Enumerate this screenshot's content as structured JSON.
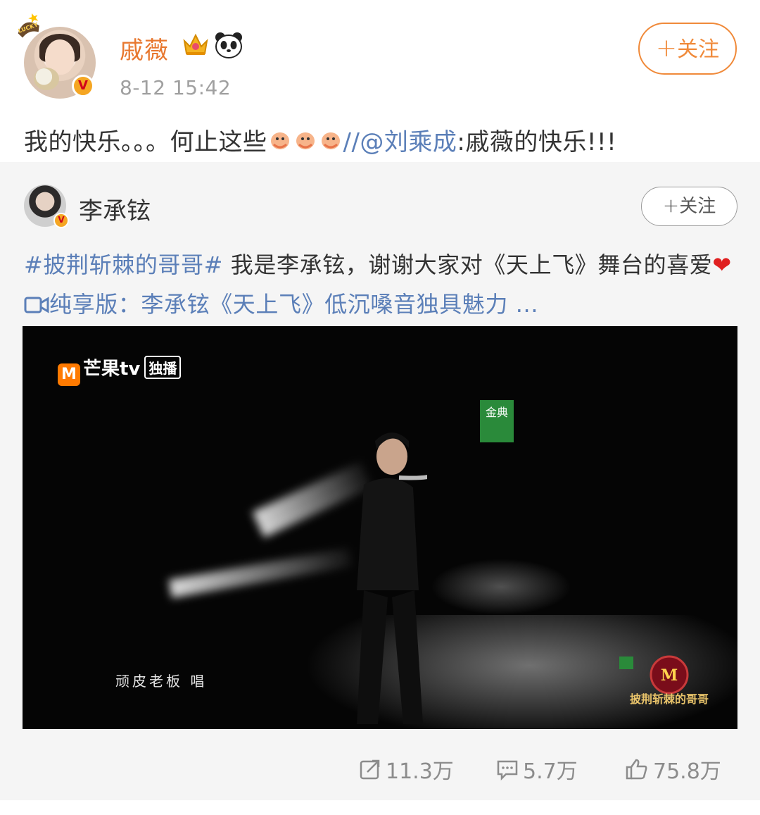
{
  "post": {
    "username": "戚薇",
    "timestamp": "8-12 15:42",
    "follow_label": "关注",
    "text_before": "我的快乐。。。何止这些",
    "text_mention": "//@刘乘成",
    "text_after": ":戚薇的快乐!!!",
    "avatar_badge": "LUCKY"
  },
  "repost": {
    "username": "李承铉",
    "follow_label": "关注",
    "hashtag": "#披荆斩棘的哥哥#",
    "text_main": " 我是李承铉，谢谢大家对《天上飞》舞台的喜爱",
    "link_text": "纯享版：李承铉《天上飞》低沉嗓音独具魅力 ...",
    "video": {
      "channel": "芒果tv",
      "channel_tag": "独播",
      "sponsor": "金典",
      "song_credit": "顽皮老板 唱",
      "show_title": "披荆斩棘的哥哥"
    }
  },
  "stats": {
    "shares": "11.3万",
    "comments": "5.7万",
    "likes": "75.8万"
  },
  "colors": {
    "username": "#e8772e",
    "follow": "#f08a3a",
    "link": "#5b7fb8",
    "muted": "#8c8c8c",
    "repost_bg": "#f5f5f5"
  },
  "icons": [
    "crown-icon",
    "panda-icon",
    "shrimp-emoji",
    "heart-icon",
    "video-icon",
    "share-icon",
    "comment-icon",
    "like-icon"
  ]
}
